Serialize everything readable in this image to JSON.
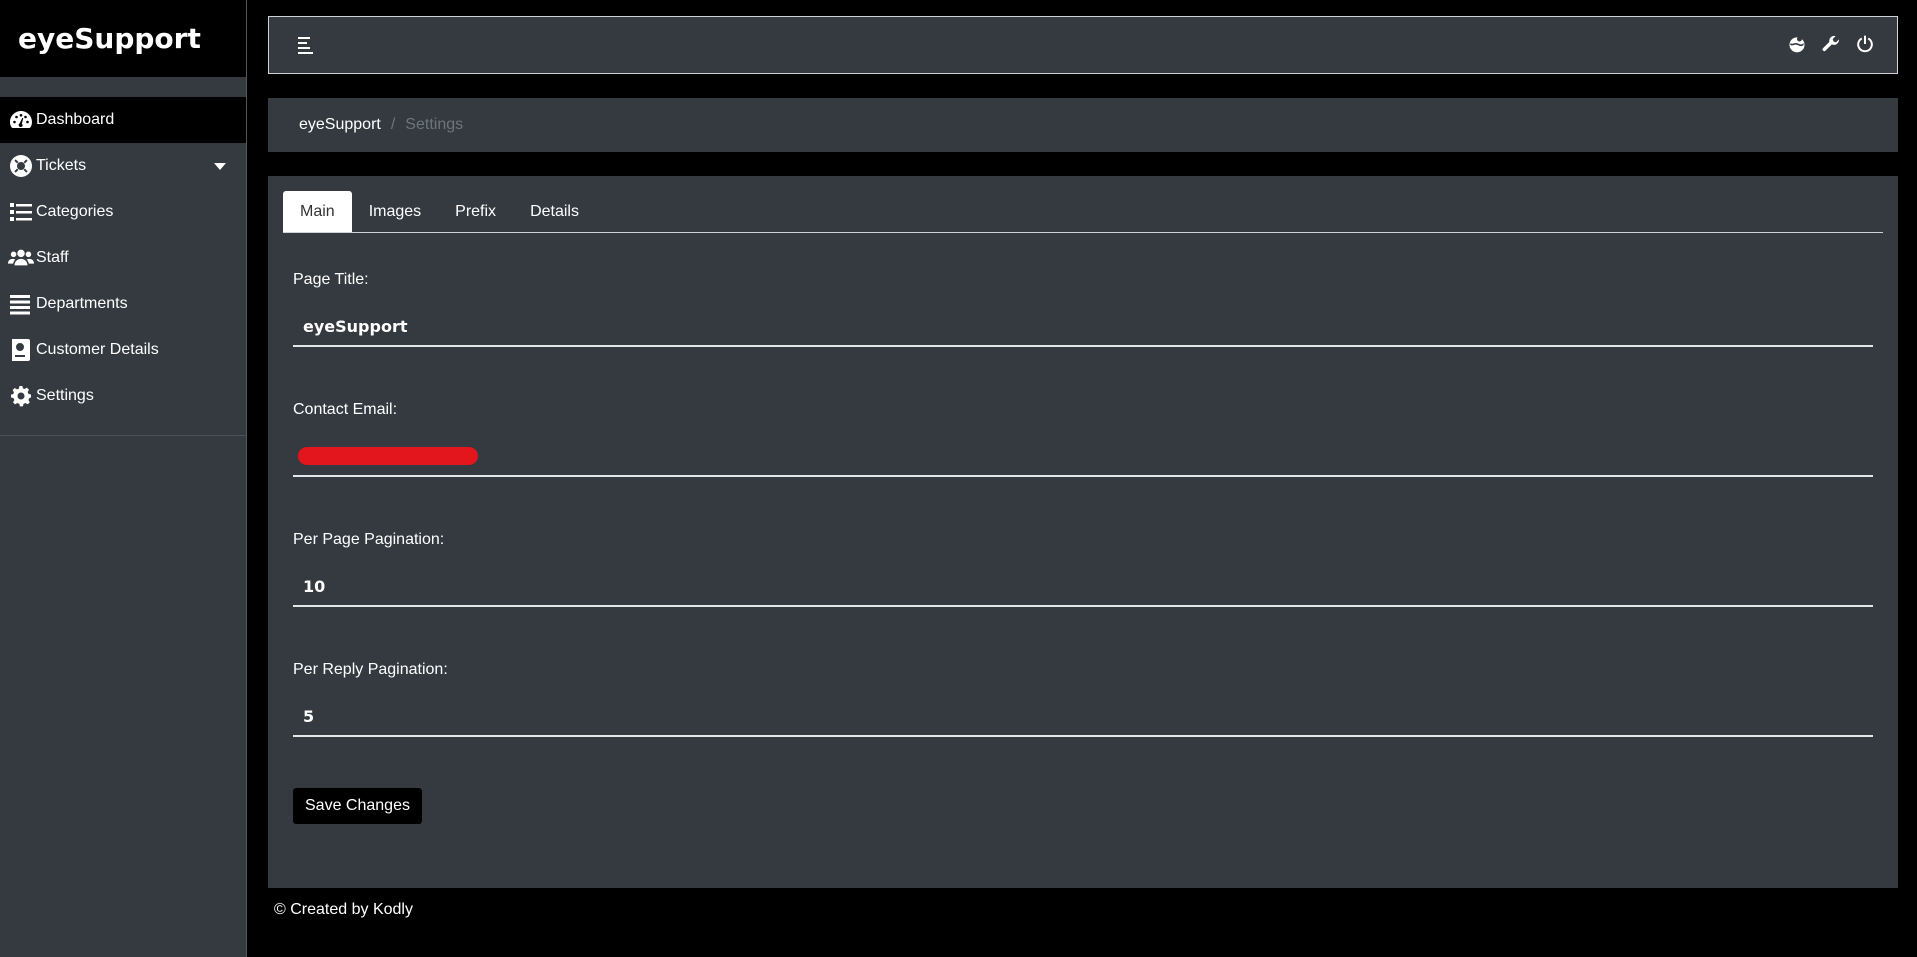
{
  "brand": "eyeSupport",
  "sidebar": {
    "items": [
      {
        "label": "Dashboard",
        "icon": "tachometer-icon",
        "active": true
      },
      {
        "label": "Tickets",
        "icon": "life-ring-icon",
        "has_dropdown": true
      },
      {
        "label": "Categories",
        "icon": "list-icon"
      },
      {
        "label": "Staff",
        "icon": "users-icon"
      },
      {
        "label": "Departments",
        "icon": "bars-icon"
      },
      {
        "label": "Customer Details",
        "icon": "address-book-icon"
      },
      {
        "label": "Settings",
        "icon": "gear-icon"
      }
    ]
  },
  "topbar": {
    "icons": [
      "hamburger-icon",
      "theme-toggle-icon",
      "wrench-icon",
      "power-icon"
    ]
  },
  "breadcrumb": {
    "home": "eyeSupport",
    "separator": "/",
    "current": "Settings"
  },
  "tabs": [
    {
      "label": "Main",
      "active": true
    },
    {
      "label": "Images"
    },
    {
      "label": "Prefix"
    },
    {
      "label": "Details"
    }
  ],
  "form": {
    "page_title": {
      "label": "Page Title:",
      "value": "eyeSupport"
    },
    "contact_email": {
      "label": "Contact Email:",
      "value": "",
      "redacted": true
    },
    "per_page": {
      "label": "Per Page Pagination:",
      "value": "10"
    },
    "per_reply": {
      "label": "Per Reply Pagination:",
      "value": "5"
    }
  },
  "save_label": "Save Changes",
  "footer": "© Created by Kodly",
  "colors": {
    "background": "#000000",
    "panel": "#343a40",
    "muted": "#6c757d",
    "redaction": "#e3151d"
  }
}
